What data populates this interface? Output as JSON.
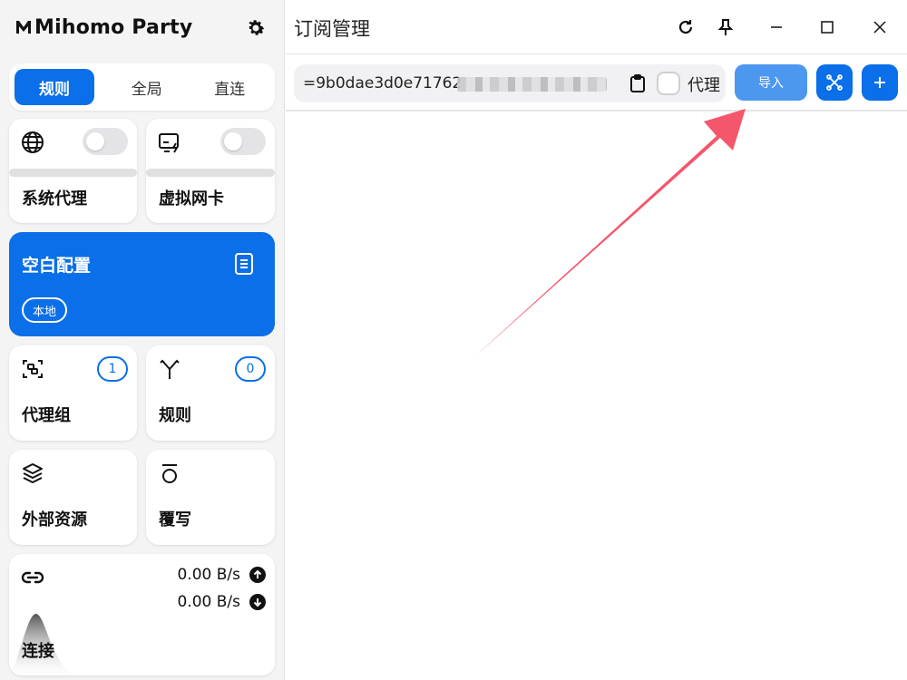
{
  "sidebar": {
    "brand": "Mihomo Party",
    "modes": [
      "规则",
      "全局",
      "直连"
    ],
    "active_mode": "规则",
    "system_proxy": {
      "label": "系统代理",
      "enabled": false
    },
    "tun": {
      "label": "虚拟网卡",
      "enabled": false
    },
    "profile": {
      "title": "空白配置",
      "badge": "本地"
    },
    "proxy_groups": {
      "label": "代理组",
      "count": "1"
    },
    "rules": {
      "label": "规则",
      "count": "0"
    },
    "resources": {
      "label": "外部资源"
    },
    "override": {
      "label": "覆写"
    },
    "connections": {
      "label": "连接",
      "upload": "0.00 B/s",
      "download": "0.00 B/s"
    }
  },
  "main": {
    "title": "订阅管理",
    "url_value": "=9b0dae3d0e71762",
    "proxy_label": "代理",
    "import_label": "导入"
  },
  "colors": {
    "accent": "#0a6fe8",
    "import": "#4c97f0",
    "arrow": "#f4566b"
  },
  "icons": {
    "settings": "gear-icon",
    "system_proxy": "globe-icon",
    "tun": "network-card-icon",
    "profile": "document-icon",
    "proxy_groups": "scan-icon",
    "rules": "fork-icon",
    "resources": "layers-icon",
    "override": "overwrite-icon",
    "connections": "link-icon",
    "refresh": "refresh-icon",
    "pin": "pin-icon",
    "minimize": "minimize-icon",
    "maximize": "maximize-icon",
    "close": "close-icon",
    "clipboard": "clipboard-icon",
    "deduplicate": "shuffle-icon",
    "add": "plus-icon"
  }
}
